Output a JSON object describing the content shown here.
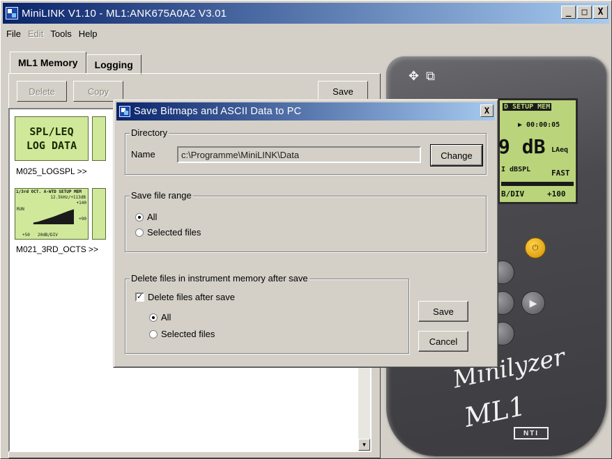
{
  "window": {
    "title": "MiniLINK V1.10 - ML1:ANK675A0A2 V3.01",
    "buttons": [
      "_",
      "□",
      "X"
    ]
  },
  "menu": [
    {
      "label": "File",
      "enabled": true
    },
    {
      "label": "Edit",
      "enabled": false
    },
    {
      "label": "Tools",
      "enabled": true
    },
    {
      "label": "Help",
      "enabled": true
    }
  ],
  "tabs": [
    {
      "label": "ML1 Memory",
      "active": true
    },
    {
      "label": "Logging",
      "active": false
    }
  ],
  "toolbar": {
    "delete_label": "Delete",
    "copy_label": "Copy",
    "save_label": "Save"
  },
  "files": [
    {
      "name": "M025_LOGSPL >>",
      "thumb_lines": [
        "SPL/LEQ",
        "LOG DATA"
      ]
    },
    {
      "name": "M021_3RD_OCTS >>",
      "thumb_lines": [
        "1/3rd OCT. A-WTD SETUP MEM",
        "12.5kHz/+113dB",
        "RUN",
        "20dB/DIV",
        "+140",
        "+90",
        "+50"
      ]
    }
  ],
  "device": {
    "lcd_lines": [
      "D SETUP MEM",
      "▶ 00:00:05",
      "9 dB",
      "LAeq",
      "I dBSPL",
      "FAST",
      "B/DIV",
      "+100"
    ],
    "brand": "Minilyzer",
    "model": "ML1",
    "logo": "NTI"
  },
  "dialog": {
    "title": "Save Bitmaps and ASCII Data to PC",
    "close_glyph": "X",
    "directory": {
      "legend": "Directory",
      "name_label": "Name",
      "path": "c:\\Programme\\MiniLINK\\Data",
      "change_label": "Change"
    },
    "range": {
      "legend": "Save file range",
      "options": [
        "All",
        "Selected files"
      ],
      "selected": "All"
    },
    "delete": {
      "legend": "Delete files in instrument memory after save",
      "checkbox_label": "Delete files after save",
      "checked": true,
      "options": [
        "All",
        "Selected files"
      ],
      "selected": "All"
    },
    "save_label": "Save",
    "cancel_label": "Cancel"
  }
}
